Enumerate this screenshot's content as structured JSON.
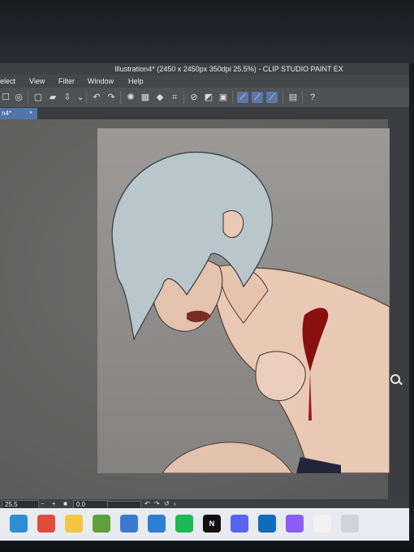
{
  "window": {
    "title": "Illustration4* (2450 x 2450px 350dpi 25.5%) - CLIP STUDIO PAINT EX"
  },
  "menu": {
    "items": [
      "elect",
      "View",
      "Filter",
      "Window",
      "Help"
    ]
  },
  "toolbar": {
    "icons": [
      "checkbox-icon",
      "clip-studio-icon",
      "new-file-icon",
      "open-folder-icon",
      "save-icon",
      "chevron-down-icon",
      "undo-icon",
      "redo-icon",
      "loading-spinner-icon",
      "transform-icon",
      "fill-icon",
      "crop-icon",
      "snap-off-icon",
      "snap-grid-icon",
      "snap-box-icon",
      "ruler-snap-icon",
      "special-ruler-icon",
      "perspective-ruler-icon",
      "layer-icon",
      "help-icon"
    ]
  },
  "tabs": [
    {
      "label": "n4*",
      "close": "×"
    }
  ],
  "status": {
    "zoom": "25.5",
    "minus": "−",
    "plus": "+",
    "rotation": "0.0"
  },
  "taskbar": {
    "apps": [
      {
        "name": "edge-icon",
        "color": "#2b8fd6",
        "label": ""
      },
      {
        "name": "chrome-icon",
        "color": "#e24a3b",
        "label": ""
      },
      {
        "name": "file-explorer-icon",
        "color": "#f4c542",
        "label": ""
      },
      {
        "name": "minecraft-icon",
        "color": "#5ea03a",
        "label": ""
      },
      {
        "name": "ms-store-icon",
        "color": "#3d7ad6",
        "label": ""
      },
      {
        "name": "mail-icon",
        "color": "#2b7fd4",
        "label": ""
      },
      {
        "name": "spotify-icon",
        "color": "#1db954",
        "label": ""
      },
      {
        "name": "netflix-icon",
        "color": "#111111",
        "label": "N"
      },
      {
        "name": "discord-icon",
        "color": "#5865f2",
        "label": ""
      },
      {
        "name": "outlook-icon",
        "color": "#0f6cbd",
        "label": ""
      },
      {
        "name": "copilot-icon",
        "color": "#8b5cf6",
        "label": ""
      },
      {
        "name": "clip-studio-taskbar-icon",
        "color": "#f2f2f2",
        "label": ""
      },
      {
        "name": "link-icon",
        "color": "#cfd4db",
        "label": ""
      }
    ]
  }
}
